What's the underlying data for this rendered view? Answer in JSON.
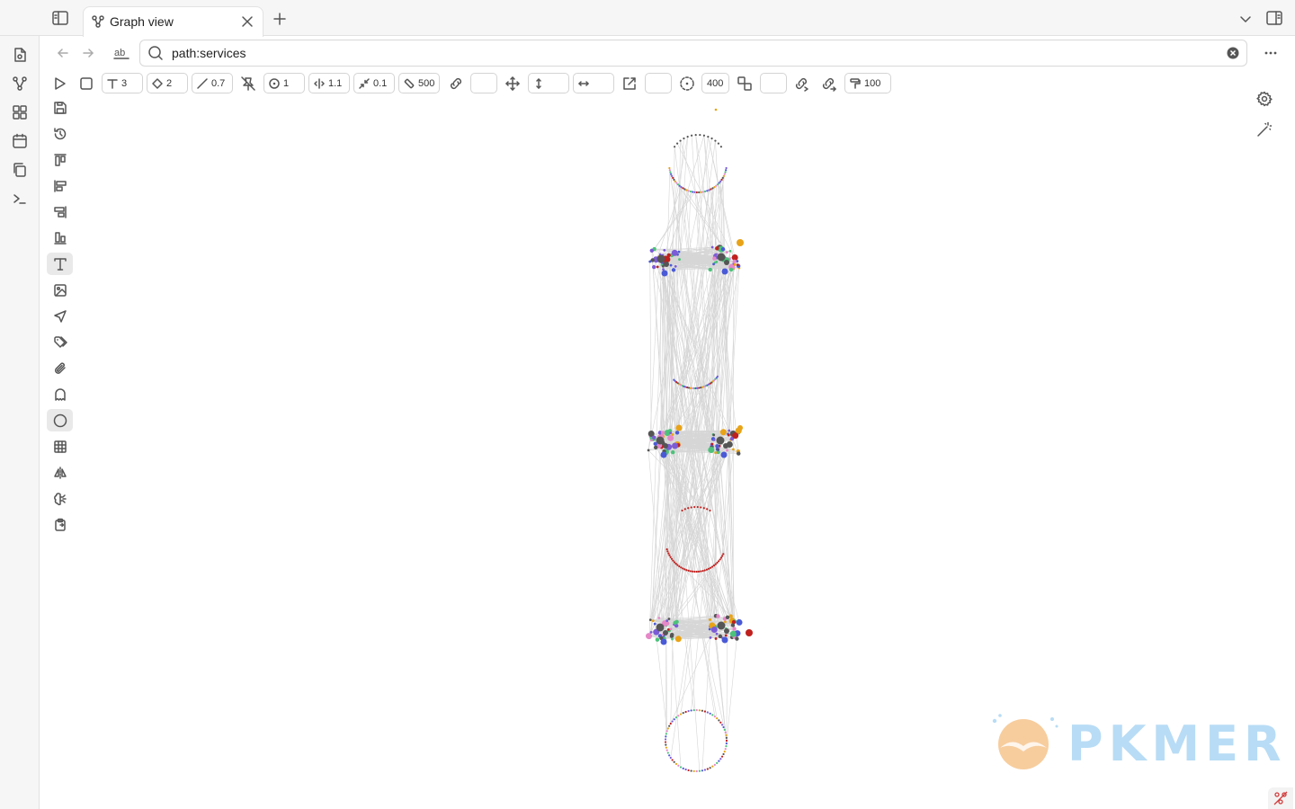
{
  "tab": {
    "title": "Graph view",
    "icon": "graph-icon"
  },
  "search": {
    "query": "path:services",
    "placeholder": ""
  },
  "graph_toolbar": {
    "text_size": "3",
    "node_size": "2",
    "line_width": "0.7",
    "center_force": "1",
    "repel_force": "1.1",
    "link_force": "0.1",
    "link_distance": "500",
    "field_a": "",
    "vertical": "",
    "horizontal": "",
    "field_b": "",
    "radius": "400",
    "field_c": "",
    "max_links": "100"
  },
  "colors": {
    "bg": "#ffffff",
    "chrome": "#f6f6f6",
    "edge": "#d6d6d6",
    "node_dark": "#555555",
    "accent_purple": "#7b5cd6",
    "blue": "#4a5ad6",
    "red": "#c0201e",
    "orange": "#e8a317",
    "green": "#4cc27a",
    "pink": "#e688c8",
    "watermark_blue": "#b8dcf5",
    "watermark_orange": "#f3b26a"
  },
  "watermark": {
    "text": "PKMER"
  }
}
